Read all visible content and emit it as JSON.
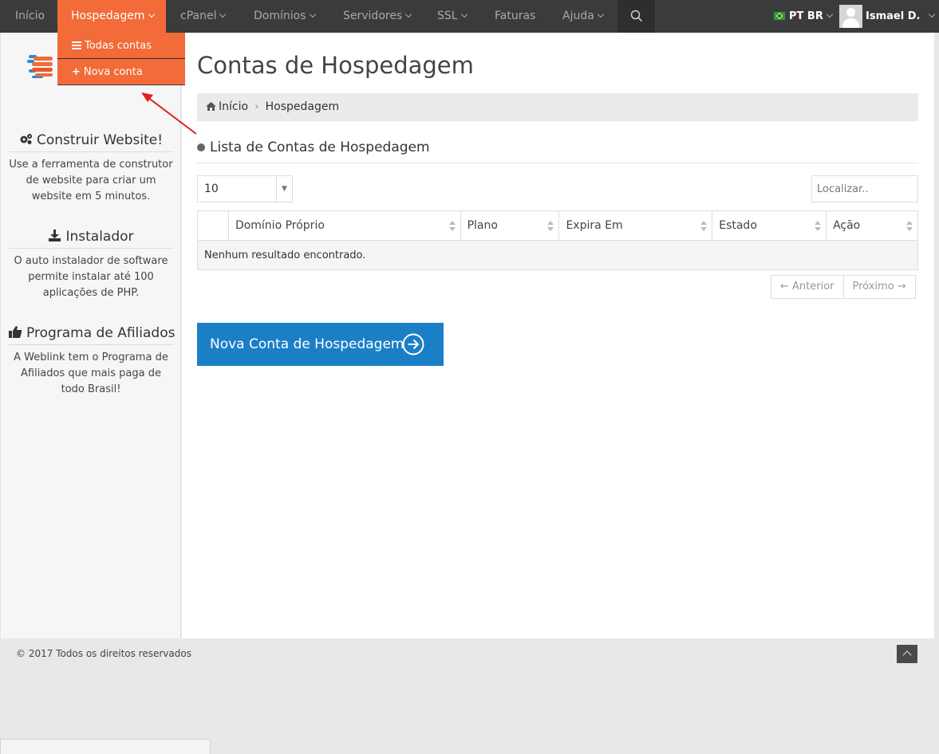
{
  "nav": {
    "items": [
      {
        "label": "Início",
        "caret": false
      },
      {
        "label": "Hospedagem",
        "caret": true,
        "active": true
      },
      {
        "label": "cPanel",
        "caret": true
      },
      {
        "label": "Domínios",
        "caret": true
      },
      {
        "label": "Servidores",
        "caret": true
      },
      {
        "label": "SSL",
        "caret": true
      },
      {
        "label": "Faturas",
        "caret": false
      },
      {
        "label": "Ajuda",
        "caret": true
      }
    ],
    "language": "PT BR",
    "user_name": "Ismael D."
  },
  "dropdown": {
    "items": [
      {
        "label": "Todas contas",
        "icon": "list-icon"
      },
      {
        "label": "Nova conta",
        "icon": "plus-icon"
      }
    ]
  },
  "sidebar": {
    "blocks": [
      {
        "title": "Construir Website!",
        "icon": "gears-icon",
        "text": "Use a ferramenta de construtor de website para criar um website em 5 minutos."
      },
      {
        "title": "Instalador",
        "icon": "download-icon",
        "text": "O auto instalador de software permite instalar até 100 aplicações de PHP."
      },
      {
        "title": "Programa de Afiliados",
        "icon": "thumbs-up-icon",
        "text": "A Weblink tem o Programa de Afiliados que mais paga de todo Brasil!"
      }
    ]
  },
  "main": {
    "title": "Contas de Hospedagem",
    "breadcrumb": {
      "home": "Início",
      "current": "Hospedagem"
    },
    "section_title": "Lista de Contas de Hospedagem",
    "page_length": "10",
    "search_placeholder": "Localizar..",
    "table": {
      "columns": [
        "Domínio Próprio",
        "Plano",
        "Expira Em",
        "Estado",
        "Ação"
      ],
      "empty_message": "Nenhum resultado encontrado."
    },
    "pager": {
      "prev": "← Anterior",
      "next": "Próximo →"
    },
    "new_button": "Nova Conta de Hospedagem"
  },
  "footer": {
    "copyright": "© 2017 Todos os direitos reservados"
  },
  "colors": {
    "nav_bg": "#3b3b3b",
    "accent": "#f26b38",
    "button": "#1b7fc6",
    "annotation_arrow": "#e02020"
  }
}
